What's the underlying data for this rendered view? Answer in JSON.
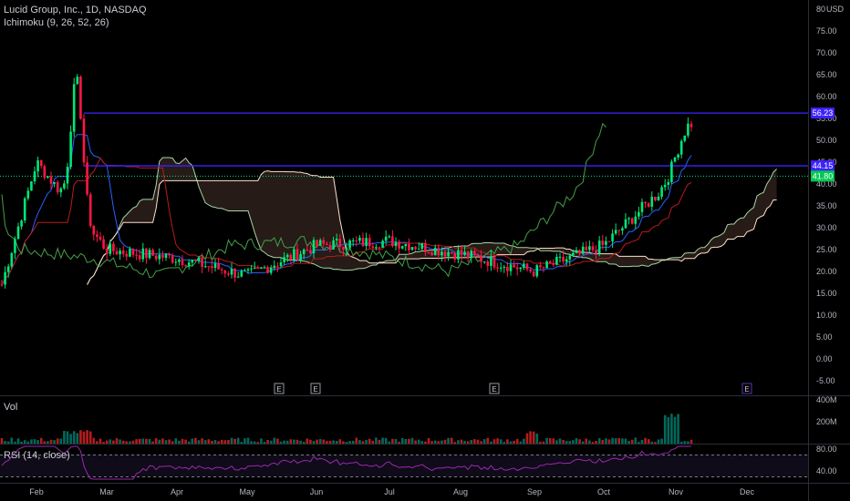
{
  "header": {
    "symbol_line": "Lucid Group, Inc., 1D, NASDAQ",
    "indicator_line": "Ichimoku (9, 26, 52, 26)"
  },
  "panes": {
    "volume_label": "Vol",
    "rsi_label": "RSI (14, close)"
  },
  "colors": {
    "up": "#26a69a",
    "up_bright": "#00e676",
    "down": "#ff1744",
    "conversion": "#2962ff",
    "base": "#b71c1c",
    "lagging": "#43a047",
    "span_a": "#a5d6a7",
    "span_b": "#ffe0cc",
    "level_line": "#3d22ff",
    "rsi": "#9c27b0"
  },
  "chart_data": {
    "type": "candlestick",
    "price_axis": {
      "unit_label": "USD",
      "ticks": [
        "80",
        "75.00",
        "70.00",
        "65.00",
        "60.00",
        "55.00",
        "50.00",
        "45.00",
        "40.00",
        "35.00",
        "30.00",
        "25.00",
        "20.00",
        "15.00",
        "10.00",
        "5.00",
        "0.00",
        "-5.00"
      ],
      "ylim": [
        -7,
        82
      ]
    },
    "time_axis": [
      "Feb",
      "Mar",
      "Apr",
      "May",
      "Jun",
      "Jul",
      "Aug",
      "Sep",
      "Oct",
      "Nov",
      "Dec"
    ],
    "horizontal_levels": [
      {
        "label": "56.23",
        "value": 56.23
      },
      {
        "label": "44.15",
        "value": 44.15
      }
    ],
    "last_price_label": "41.80",
    "last_price": 41.8,
    "earnings_markers": [
      "E",
      "E",
      "E",
      "E"
    ],
    "volume_axis": [
      "400M",
      "200M"
    ],
    "rsi_axis": [
      "80.00",
      "40.00"
    ],
    "rsi_bands": [
      70,
      30
    ],
    "monthly_close": [
      {
        "month": "Feb",
        "close": 45
      },
      {
        "month": "Mar",
        "close": 25
      },
      {
        "month": "Apr",
        "close": 23
      },
      {
        "month": "May",
        "close": 19
      },
      {
        "month": "Jun",
        "close": 26
      },
      {
        "month": "Jul",
        "close": 27
      },
      {
        "month": "Aug",
        "close": 24
      },
      {
        "month": "Sep",
        "close": 20
      },
      {
        "month": "Oct",
        "close": 26
      },
      {
        "month": "Nov",
        "close": 41.8
      }
    ]
  }
}
